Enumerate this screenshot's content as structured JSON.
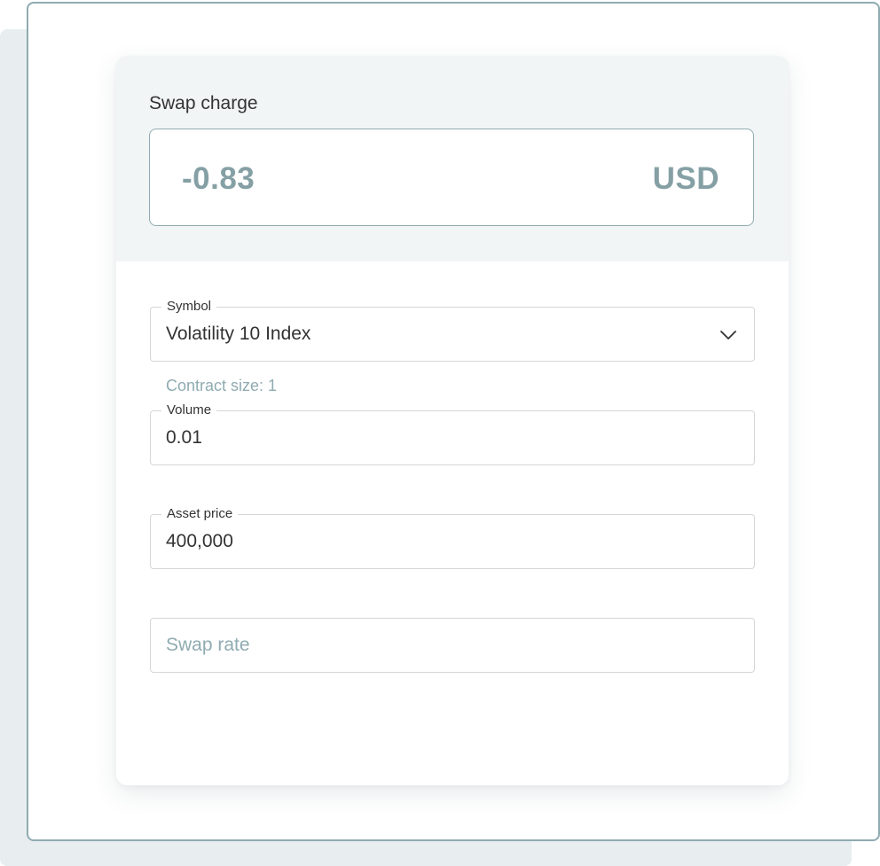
{
  "calculator": {
    "result": {
      "label": "Swap charge",
      "value": "-0.83",
      "currency": "USD"
    },
    "symbol": {
      "label": "Symbol",
      "value": "Volatility 10 Index",
      "hint": "Contract size: 1"
    },
    "volume": {
      "label": "Volume",
      "value": "0.01"
    },
    "asset_price": {
      "label": "Asset price",
      "value": "400,000"
    },
    "swap_rate": {
      "placeholder": "Swap rate"
    }
  },
  "icons": {
    "dropdown": "chevron-down-icon"
  },
  "colors": {
    "accent": "#85a0a5",
    "frame_border": "#8fabb1",
    "result_background": "#f2f5f6",
    "backdrop": "#e8eef0",
    "text": "#333333",
    "field_border": "#d6d6d6"
  }
}
